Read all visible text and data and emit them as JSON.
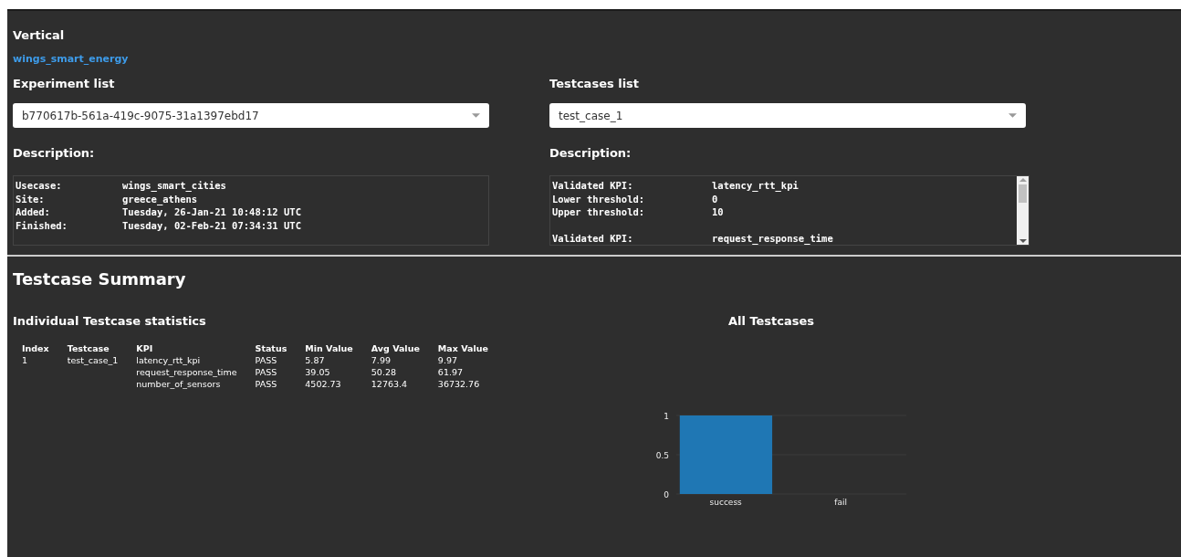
{
  "vertical": {
    "heading": "Vertical",
    "link": "wings_smart_energy"
  },
  "experiments": {
    "heading": "Experiment list",
    "value": "b770617b-561a-419c-9075-31a1397ebd17",
    "description_heading": "Description:",
    "description_groups": [
      [
        {
          "label": "Usecase:",
          "value": "wings_smart_cities"
        },
        {
          "label": "Site:",
          "value": "greece_athens"
        },
        {
          "label": "Added:",
          "value": "Tuesday, 26-Jan-21 10:48:12 UTC"
        },
        {
          "label": "Finished:",
          "value": "Tuesday, 02-Feb-21 07:34:31 UTC"
        }
      ]
    ]
  },
  "testcases": {
    "heading": "Testcases list",
    "value": "test_case_1",
    "description_heading": "Description:",
    "description_groups": [
      [
        {
          "label": "Validated KPI:",
          "value": "latency_rtt_kpi"
        },
        {
          "label": "Lower threshold:",
          "value": "0"
        },
        {
          "label": "Upper threshold:",
          "value": "10"
        }
      ],
      [
        {
          "label": "Validated KPI:",
          "value": "request_response_time"
        }
      ]
    ]
  },
  "summary": {
    "title": "Testcase Summary",
    "table_title": "Individual Testcase statistics",
    "columns": [
      "Index",
      "Testcase",
      "KPI",
      "Status",
      "Min Value",
      "Avg Value",
      "Max Value"
    ],
    "rows": [
      [
        "1",
        "test_case_1",
        "latency_rtt_kpi",
        "PASS",
        "5.87",
        "7.99",
        "9.97"
      ],
      [
        "",
        "",
        "request_response_time",
        "PASS",
        "39.05",
        "50.28",
        "61.97"
      ],
      [
        "",
        "",
        "number_of_sensors",
        "PASS",
        "4502.73",
        "12763.4",
        "36732.76"
      ]
    ],
    "chart_data": {
      "type": "bar",
      "title": "All Testcases",
      "categories": [
        "success",
        "fail"
      ],
      "series": [
        {
          "color": "#1f77b4",
          "values": [
            1,
            0
          ]
        }
      ],
      "ylim": [
        0,
        1
      ],
      "yticks": [
        0,
        0.5,
        1
      ]
    }
  }
}
